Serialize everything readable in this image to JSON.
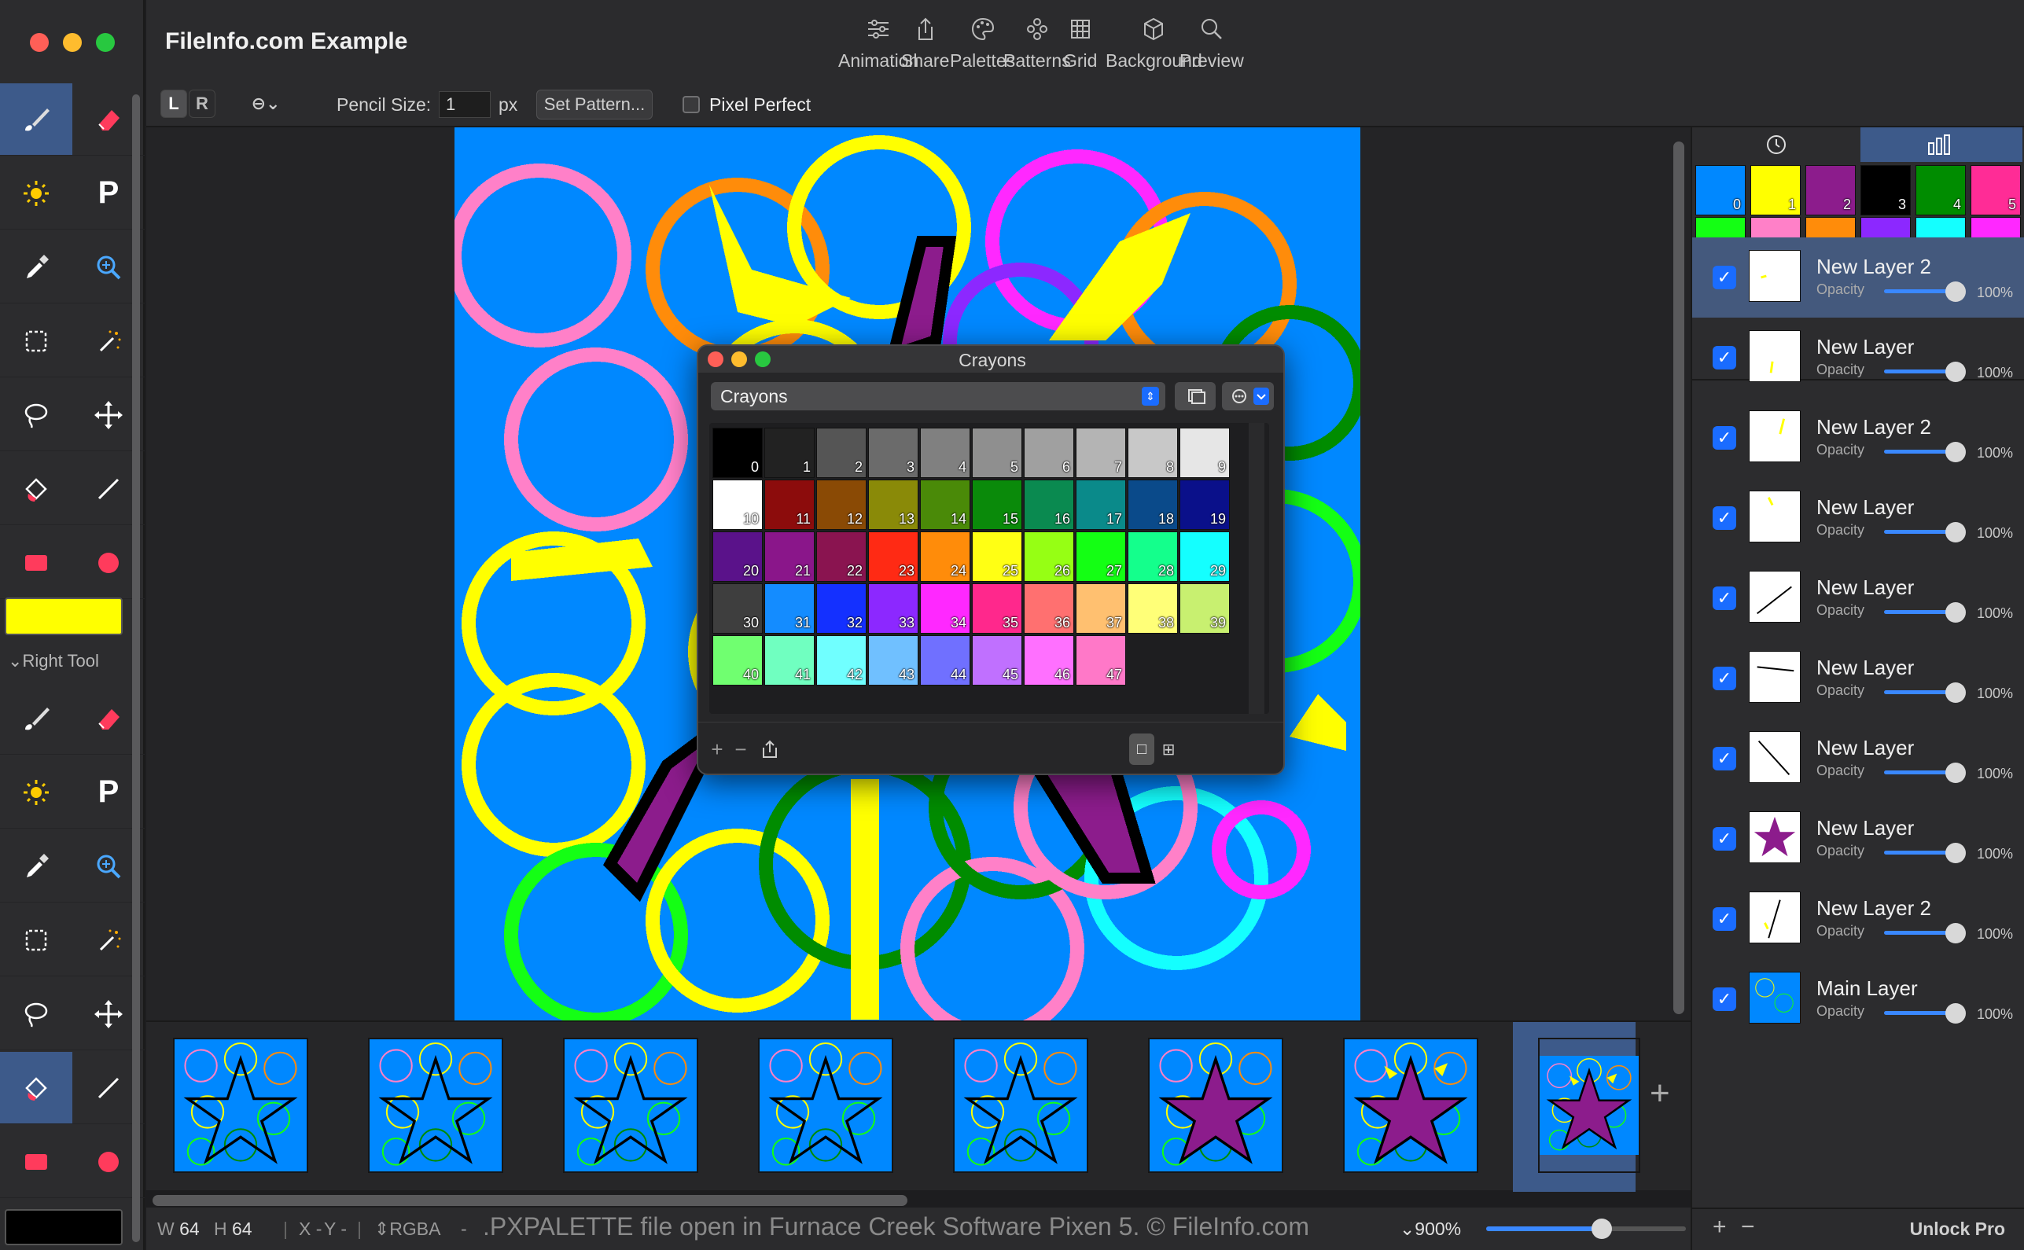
{
  "window": {
    "title": "FileInfo.com Example"
  },
  "toolbar": {
    "items": [
      {
        "label": "Animation",
        "icon": "sliders-icon"
      },
      {
        "label": "Share",
        "icon": "share-icon"
      },
      {
        "label": "Palettes",
        "icon": "palette-icon"
      },
      {
        "label": "Patterns",
        "icon": "patterns-icon"
      },
      {
        "label": "Grid",
        "icon": "grid-icon"
      },
      {
        "label": "Background",
        "icon": "background-icon"
      },
      {
        "label": "Preview",
        "icon": "magnifier-icon"
      }
    ]
  },
  "options": {
    "left_btn": "L",
    "right_btn": "R",
    "pencil_size_label": "Pencil Size:",
    "pencil_size_value": "1",
    "px_unit": "px",
    "set_pattern": "Set Pattern...",
    "pixel_perfect": "Pixel Perfect"
  },
  "left_tool": {
    "color": "#ffff00"
  },
  "right_tool": {
    "label": "Right Tool",
    "color": "#000000"
  },
  "crayons_panel": {
    "title": "Crayons",
    "selected_palette": "Crayons",
    "swatches": [
      "#000000",
      "#222222",
      "#555555",
      "#6b6b6b",
      "#808080",
      "#8f8f8f",
      "#a0a0a0",
      "#b4b4b4",
      "#c8c8c8",
      "#e6e6e6",
      "#ffffff",
      "#8c0c0c",
      "#8a4a05",
      "#8a8a08",
      "#4a8a08",
      "#0a8a0a",
      "#0a8a50",
      "#0a8a8a",
      "#0a4a8a",
      "#0a108a",
      "#5a128a",
      "#8a168a",
      "#8a1450",
      "#ff2a14",
      "#ff8c0a",
      "#ffff14",
      "#96ff14",
      "#14ff14",
      "#14ff8c",
      "#14ffff",
      "#3e3e3e",
      "#148cff",
      "#1430ff",
      "#8c28ff",
      "#ff28ff",
      "#ff288c",
      "#ff7070",
      "#ffc070",
      "#ffff78",
      "#c8f070",
      "#70ff70",
      "#70ffc0",
      "#70ffff",
      "#70c0ff",
      "#7070ff",
      "#c070ff",
      "#ff70ff",
      "#ff78c8"
    ]
  },
  "palette_strip": {
    "swatches": [
      "#0088ff",
      "#ffff00",
      "#8c1c8c",
      "#000000",
      "#008c00",
      "#ff2c96",
      "#14ff14",
      "#ff80c8",
      "#ff8c0a",
      "#8c28ff",
      "#14ffff",
      "#ff28ff"
    ]
  },
  "timeline": {
    "frame_count": 8,
    "selected_frame": 8
  },
  "status": {
    "w_label": "W",
    "w_value": "64",
    "h_label": "H",
    "h_value": "64",
    "x_label": "X",
    "x_value": "-",
    "y_label": "Y",
    "y_value": "-",
    "color_mode": "RGBA",
    "color_value": "-",
    "caption": ".PXPALETTE file open in Furnace Creek Software Pixen 5. © FileInfo.com",
    "zoom": "900%",
    "zoom_level": 0.58
  },
  "layers": [
    {
      "name": "New Layer 2",
      "opacity_label": "Opacity",
      "opacity": "100%",
      "selected": true
    },
    {
      "name": "New Layer",
      "opacity_label": "Opacity",
      "opacity": "100%"
    },
    {
      "name": "New Layer 2",
      "opacity_label": "Opacity",
      "opacity": "100%"
    },
    {
      "name": "New Layer",
      "opacity_label": "Opacity",
      "opacity": "100%"
    },
    {
      "name": "New Layer",
      "opacity_label": "Opacity",
      "opacity": "100%"
    },
    {
      "name": "New Layer",
      "opacity_label": "Opacity",
      "opacity": "100%"
    },
    {
      "name": "New Layer",
      "opacity_label": "Opacity",
      "opacity": "100%"
    },
    {
      "name": "New Layer",
      "opacity_label": "Opacity",
      "opacity": "100%"
    },
    {
      "name": "New Layer 2",
      "opacity_label": "Opacity",
      "opacity": "100%"
    },
    {
      "name": "Main Layer",
      "opacity_label": "Opacity",
      "opacity": "100%"
    }
  ],
  "right_footer": {
    "add": "+",
    "remove": "−",
    "unlock": "Unlock Pro"
  }
}
